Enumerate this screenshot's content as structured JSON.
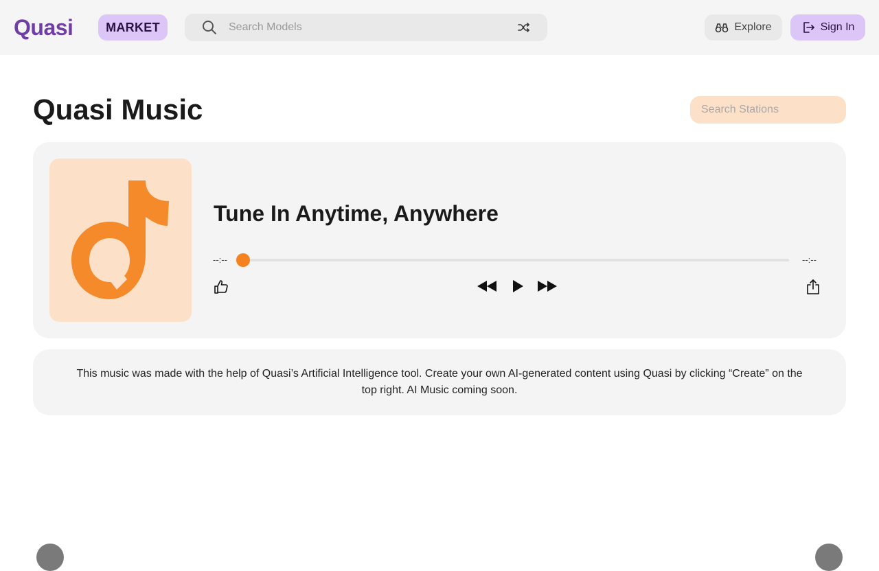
{
  "brand": {
    "name": "Quasi",
    "market_label": "MARKET",
    "accent": "#6f3fa6"
  },
  "header": {
    "search_placeholder": "Search Models",
    "explore_label": "Explore",
    "signin_label": "Sign In"
  },
  "page": {
    "title": "Quasi Music",
    "station_search_placeholder": "Search Stations"
  },
  "player": {
    "track_title": "Tune In Anytime, Anywhere",
    "time_elapsed": "--:--",
    "time_total": "--:--",
    "progress": 0,
    "accent": "#f58220",
    "icons": [
      "thumbs-up-icon",
      "rewind-icon",
      "play-icon",
      "fast-forward-icon",
      "share-icon"
    ]
  },
  "info": {
    "text": "This music was made with the help of Quasi’s Artificial Intelligence tool. Create your own AI-generated content using Quasi by clicking “Create” on the top right. AI Music coming soon."
  }
}
